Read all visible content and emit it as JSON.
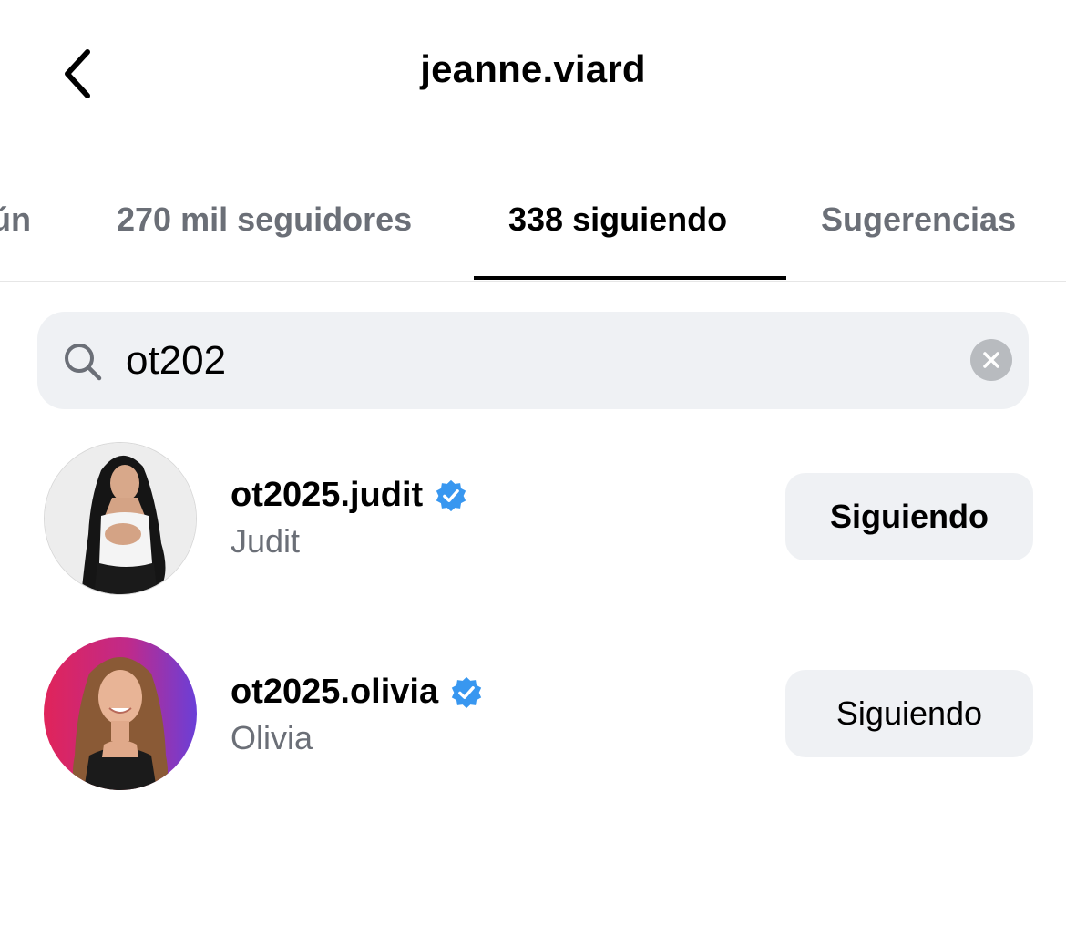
{
  "header": {
    "title": "jeanne.viard",
    "back_icon": "chevron-left-icon"
  },
  "tabs": [
    {
      "label": "ún"
    },
    {
      "label": "270 mil seguidores"
    },
    {
      "label": "338 siguiendo",
      "active": true
    },
    {
      "label": "Sugerencias"
    }
  ],
  "search": {
    "icon": "search-icon",
    "value": "ot202",
    "clear_icon": "clear-icon"
  },
  "accounts": [
    {
      "username": "ot2025.judit",
      "full_name": "Judit",
      "verified": true,
      "button_label": "Siguiendo"
    },
    {
      "username": "ot2025.olivia",
      "full_name": "Olivia",
      "verified": true,
      "button_label": "Siguiendo"
    }
  ],
  "colors": {
    "verified_blue": "#3897f0",
    "muted_text": "#6b6f77",
    "button_bg": "#eff1f4"
  }
}
